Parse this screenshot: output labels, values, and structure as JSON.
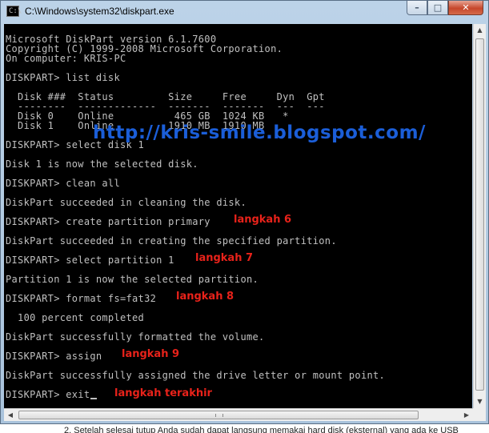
{
  "window": {
    "title": "C:\\Windows\\system32\\diskpart.exe",
    "buttons": {
      "minimize": "–",
      "restore": "□",
      "close": "✕"
    },
    "app_icon_text": "C:\\"
  },
  "console": {
    "lines": [
      "Microsoft DiskPart version 6.1.7600",
      "Copyright (C) 1999-2008 Microsoft Corporation.",
      "On computer: KRIS-PC",
      "",
      "DISKPART> list disk",
      "",
      "  Disk ###  Status         Size     Free     Dyn  Gpt",
      "  --------  -------------  -------  -------  ---  ---",
      "  Disk 0    Online          465 GB  1024 KB   *",
      "  Disk 1    Online         1910 MB  1910 MB",
      "",
      "DISKPART> select disk 1",
      "",
      "Disk 1 is now the selected disk.",
      "",
      "DISKPART> clean all",
      "",
      "DiskPart succeeded in cleaning the disk.",
      "",
      "DISKPART> create partition primary",
      "",
      "DiskPart succeeded in creating the specified partition.",
      "",
      "DISKPART> select partition 1",
      "",
      "Partition 1 is now the selected partition.",
      "",
      "DISKPART> format fs=fat32",
      "",
      "  100 percent completed",
      "",
      "DiskPart successfully formatted the volume.",
      "",
      "DISKPART> assign",
      "",
      "DiskPart successfully assigned the drive letter or mount point.",
      "",
      "DISKPART> exit"
    ],
    "annotations": {
      "step6": "langkah 6",
      "step7": "langkah 7",
      "step8": "langkah 8",
      "step9": "langkah 9",
      "final": "langkah terakhir"
    },
    "watermark": "http://kris-smile.blogspot.com/"
  },
  "below_window_text": "2. Setelah selesai tutup Anda sudah dapat langsung memakai hard disk (eksternal) yang ada ke USB",
  "colors": {
    "console_bg": "#000000",
    "console_text": "#c0c0c0",
    "annotation": "#e8221a",
    "watermark": "#1b5ed8"
  }
}
